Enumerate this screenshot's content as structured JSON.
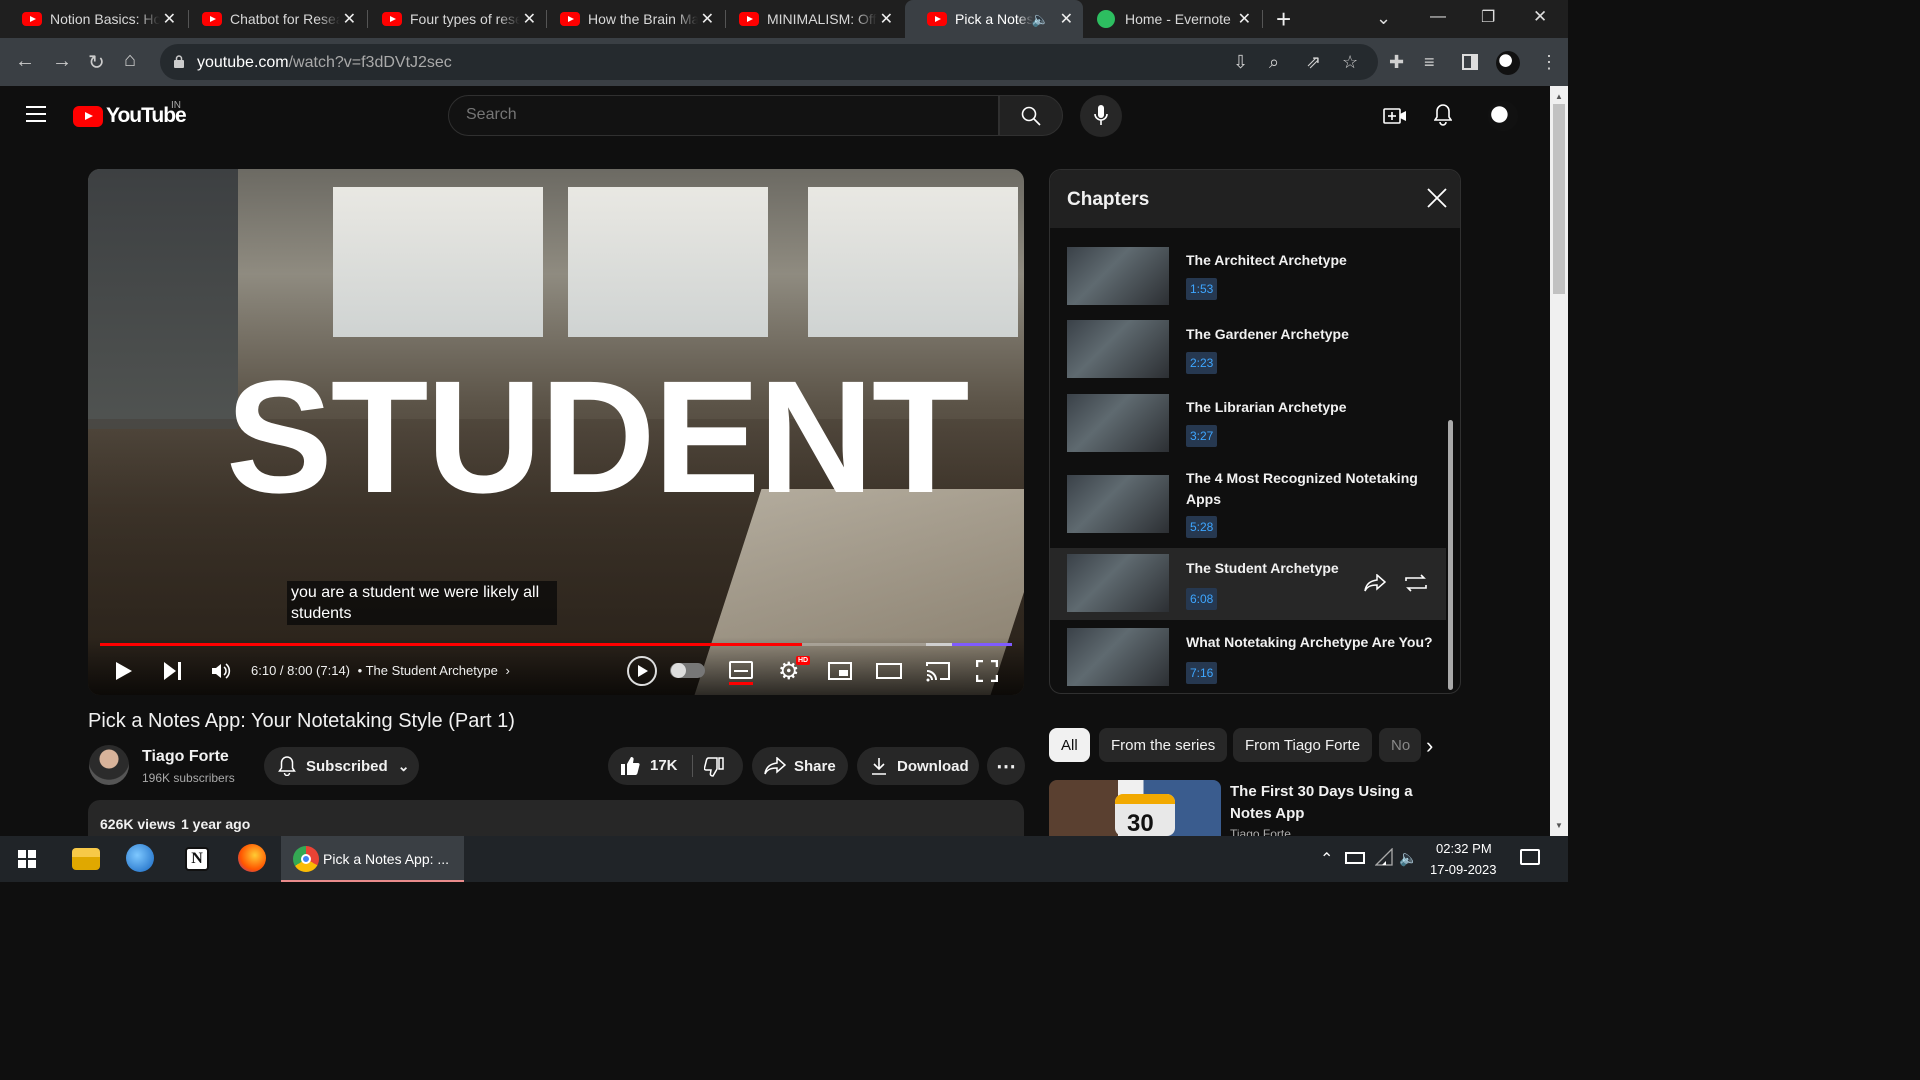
{
  "browser": {
    "tabs": [
      {
        "title": "Notion Basics: How",
        "active": false
      },
      {
        "title": "Chatbot for Resea",
        "active": false
      },
      {
        "title": "Four types of rese",
        "active": false
      },
      {
        "title": "How the Brain Ma",
        "active": false
      },
      {
        "title": "MINIMALISM: Off",
        "active": false
      },
      {
        "title": "Pick a Notes A",
        "active": true
      },
      {
        "title": "Home - Evernote",
        "active": false
      }
    ],
    "new_tab": "+",
    "url_host": "youtube.com",
    "url_path": "/watch?v=f3dDVtJ2sec",
    "window_controls": [
      "⌄",
      "—",
      "❐",
      "✕"
    ]
  },
  "youtube": {
    "logo": "YouTube",
    "region": "IN",
    "search_placeholder": "Search"
  },
  "player": {
    "overlay_text": "STUDENT",
    "caption": "you are a student we were likely all students",
    "time": "6:10 / 8:00 (7:14)",
    "chapter_label": "• The Student Archetype",
    "progress_fraction": 0.77,
    "hd_badge": "HD"
  },
  "chapters": {
    "heading": "Chapters",
    "items": [
      {
        "title": "The Architect Archetype",
        "time": "1:53",
        "active": false
      },
      {
        "title": "The Gardener Archetype",
        "time": "2:23",
        "active": false
      },
      {
        "title": "The Librarian Archetype",
        "time": "3:27",
        "active": false
      },
      {
        "title": "The 4 Most Recognized Notetaking Apps",
        "time": "5:28",
        "active": false
      },
      {
        "title": "The Student Archetype",
        "time": "6:08",
        "active": true
      },
      {
        "title": "What Notetaking Archetype Are You?",
        "time": "7:16",
        "active": false
      }
    ]
  },
  "video": {
    "title": "Pick a Notes App: Your Notetaking Style (Part 1)",
    "channel": "Tiago Forte",
    "subscribers": "196K subscribers",
    "subscribed_label": "Subscribed",
    "likes": "17K",
    "share_label": "Share",
    "download_label": "Download",
    "views": "626K views",
    "age": "1 year ago"
  },
  "chips": [
    "All",
    "From the series",
    "From Tiago Forte",
    "No"
  ],
  "related": {
    "title": "The First 30 Days Using a Notes App",
    "channel": "Tiago Forte",
    "thumb_number": "30"
  },
  "taskbar": {
    "chrome_label": "Pick a Notes App: ...",
    "time": "02:32 PM",
    "date": "17-09-2023"
  }
}
